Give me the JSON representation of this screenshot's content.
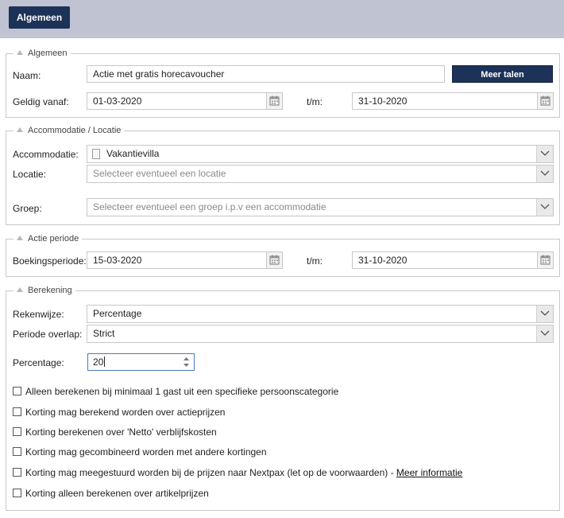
{
  "tab": {
    "label": "Algemeen"
  },
  "sections": {
    "algemeen": {
      "legend": "Algemeen",
      "naam_label": "Naam:",
      "naam_value": "Actie met gratis horecavoucher",
      "meer_talen": "Meer talen",
      "geldig_label": "Geldig vanaf:",
      "geldig_value": "01-03-2020",
      "tm_label": "t/m:",
      "tm_value": "31-10-2020"
    },
    "accommodatie": {
      "legend": "Accommodatie / Locatie",
      "acc_label": "Accommodatie:",
      "acc_value": "Vakantievilla",
      "loc_label": "Locatie:",
      "loc_placeholder": "Selecteer eventueel een locatie",
      "groep_label": "Groep:",
      "groep_placeholder": "Selecteer eventueel een groep i.p.v een accommodatie"
    },
    "periode": {
      "legend": "Actie periode",
      "boek_label": "Boekingsperiode:",
      "boek_value": "15-03-2020",
      "tm_label": "t/m:",
      "tm_value": "31-10-2020"
    },
    "berekening": {
      "legend": "Berekening",
      "rekenwijze_label": "Rekenwijze:",
      "rekenwijze_value": "Percentage",
      "overlap_label": "Periode overlap:",
      "overlap_value": "Strict",
      "percentage_label": "Percentage:",
      "percentage_value": "20",
      "checkboxes": [
        {
          "label": "Alleen berekenen bij minimaal 1 gast uit een specifieke persoonscategorie",
          "checked": false
        },
        {
          "label": "Korting mag berekend worden over actieprijzen",
          "checked": false
        },
        {
          "label": "Korting berekenen over 'Netto' verblijfskosten",
          "checked": false
        },
        {
          "label": "Korting mag gecombineerd worden met andere kortingen",
          "checked": false
        },
        {
          "label": "Korting mag meegestuurd worden bij de prijzen naar Nextpax (let op de voorwaarden) - ",
          "link": "Meer informatie",
          "checked": false
        },
        {
          "label": "Korting alleen berekenen over artikelprijzen",
          "checked": false
        }
      ]
    }
  },
  "icons": {
    "calendar": "calendar-icon",
    "dropdown": "chevron-down-icon",
    "collapse": "triangle-up-icon",
    "spinner": "spinner-arrows-icon",
    "document": "document-icon"
  },
  "colors": {
    "accent": "#1d3258",
    "tabbar": "#bfc3d2",
    "focus_border": "#4a79c0"
  }
}
